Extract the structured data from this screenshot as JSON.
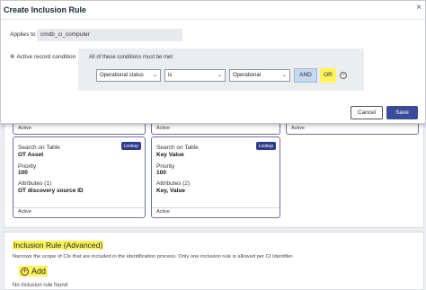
{
  "modal": {
    "title": "Create Inclusion Rule",
    "close_icon": "×",
    "applies_to_label": "Applies to",
    "applies_to_value": "cmdb_ci_computer",
    "arc_asterisk": "✻",
    "arc_label": "Active record condition",
    "conditions_heading": "All of these conditions must be met",
    "field_select": "Operational status",
    "operator_select": "is",
    "value_select": "Operational",
    "caret": "⌄",
    "and_label": "AND",
    "or_label": "OR",
    "remove_icon": "−",
    "cancel_label": "Cancel",
    "save_label": "Save"
  },
  "cards_stub": [
    {
      "active": "Active"
    },
    {
      "active": "Active"
    },
    {
      "active": "Active"
    }
  ],
  "cards": [
    {
      "badge": "Lookup",
      "search_label": "Search on Table",
      "table": "OT Asset",
      "priority_label": "Priority",
      "priority": "100",
      "attributes_label": "Attributes (1)",
      "attributes": "OT discovery source ID",
      "active": "Active"
    },
    {
      "badge": "Lookup",
      "search_label": "Search on Table",
      "table": "Key Value",
      "priority_label": "Priority",
      "priority": "100",
      "attributes_label": "Attributes (2)",
      "attributes": "Key, Value",
      "active": "Active"
    }
  ],
  "advanced": {
    "title": "Inclusion Rule (Advanced)",
    "description": "Narrows the scope of CIs that are included in the identification process. Only one inclusion rule is allowed per CI Identifier.",
    "add_icon": "+",
    "add_label": "Add",
    "empty_text": "No inclusion rule found"
  },
  "colors": {
    "highlight": "#fff35a",
    "primary": "#3c4a9a",
    "card_border": "#6d6fa6",
    "badge": "#2e3a8c"
  }
}
